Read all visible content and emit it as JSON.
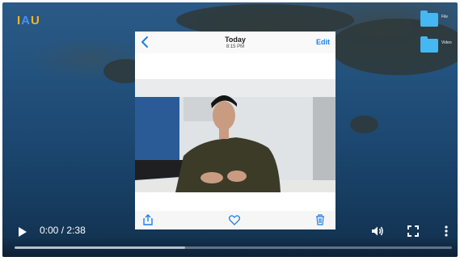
{
  "player": {
    "current_time": "0:00",
    "separator": "/",
    "duration": "2:38",
    "buffered_fraction": 0.39,
    "icons": {
      "play": "play-icon",
      "volume": "volume-icon",
      "fullscreen": "fullscreen-icon",
      "more": "more-vert-icon"
    }
  },
  "desktop": {
    "logo": {
      "part1": "I",
      "part2": "A",
      "part3": "U"
    },
    "icons": [
      {
        "label": "File",
        "icon": "folder-icon"
      },
      {
        "label": "Video",
        "icon": "folder-icon"
      }
    ]
  },
  "phone": {
    "header": {
      "title": "Today",
      "time": "8:15 PM",
      "edit_label": "Edit",
      "back_icon": "chevron-left-icon"
    },
    "toolbar": {
      "share_icon": "share-icon",
      "favorite_icon": "heart-icon",
      "delete_icon": "trash-icon"
    },
    "accent_color": "#1e7ee8"
  }
}
